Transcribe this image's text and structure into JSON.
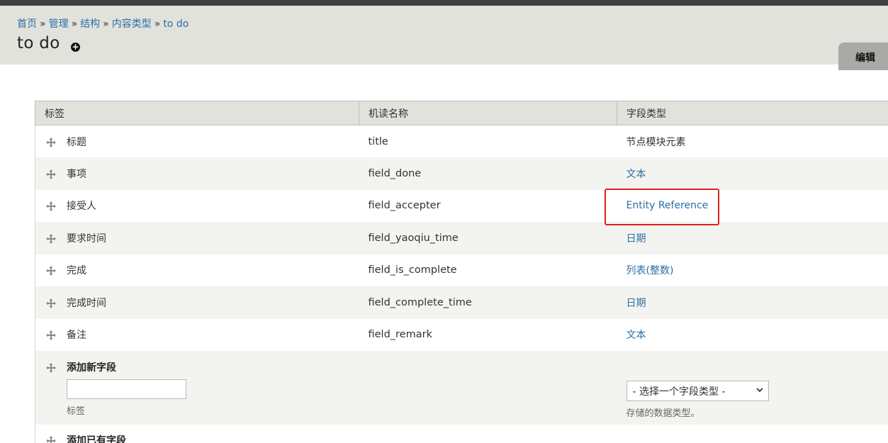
{
  "breadcrumb": {
    "home": "首页",
    "admin": "管理",
    "structure": "结构",
    "content_types": "内容类型",
    "current": "to do"
  },
  "page": {
    "title": "to do",
    "shortcut_icon": "plus-circle-icon"
  },
  "tabs": {
    "edit": "编辑"
  },
  "table": {
    "headers": {
      "label": "标签",
      "machine": "机读名称",
      "type": "字段类型"
    },
    "rows": [
      {
        "label": "标题",
        "machine": "title",
        "type": "节点模块元素",
        "type_link": false
      },
      {
        "label": "事项",
        "machine": "field_done",
        "type": "文本",
        "type_link": true
      },
      {
        "label": "接受人",
        "machine": "field_accepter",
        "type": "Entity Reference",
        "type_link": true
      },
      {
        "label": "要求时间",
        "machine": "field_yaoqiu_time",
        "type": "日期",
        "type_link": true
      },
      {
        "label": "完成",
        "machine": "field_is_complete",
        "type": "列表(整数)",
        "type_link": true
      },
      {
        "label": "完成时间",
        "machine": "field_complete_time",
        "type": "日期",
        "type_link": true
      },
      {
        "label": "备注",
        "machine": "field_remark",
        "type": "文本",
        "type_link": true
      }
    ],
    "add_new": {
      "title": "添加新字段",
      "label_placeholder": "",
      "label_desc": "标签",
      "select_value": "- 选择一个字段类型 -",
      "select_desc": "存储的数据类型。"
    },
    "add_existing": {
      "title": "添加已有字段"
    }
  },
  "colors": {
    "link": "#2a6fa8",
    "highlight": "#e02020",
    "header_bg": "#e2e2dc"
  }
}
